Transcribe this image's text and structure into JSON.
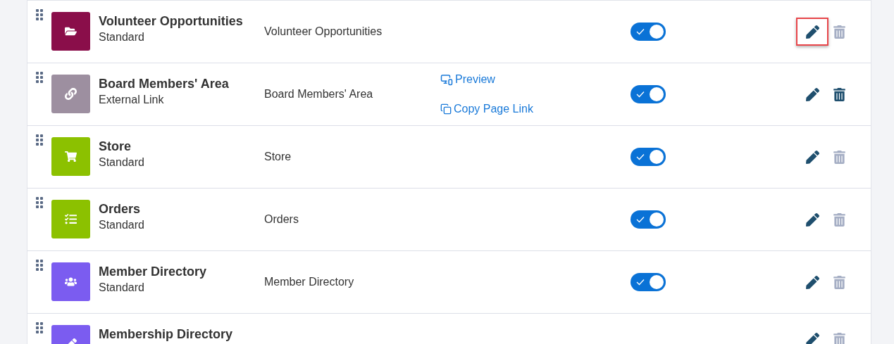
{
  "rows": [
    {
      "kind": "folder",
      "color": "#8a0e4a",
      "title": "Volunteer Opportunities",
      "subtitle": "Standard",
      "page_name": "Volunteer Opportunities",
      "links": [],
      "enabled": true,
      "edit_highlighted": true,
      "delete_disabled": true
    },
    {
      "kind": "link",
      "color": "#9d8fa0",
      "title": "Board Members' Area",
      "subtitle": "External Link",
      "page_name": "Board Members' Area",
      "links": [
        {
          "kind": "preview",
          "label": "Preview"
        },
        {
          "kind": "copy",
          "label": "Copy Page Link"
        }
      ],
      "enabled": true,
      "edit_highlighted": false,
      "delete_disabled": false
    },
    {
      "kind": "cart",
      "color": "#8cc100",
      "title": "Store",
      "subtitle": "Standard",
      "page_name": "Store",
      "links": [],
      "enabled": true,
      "edit_highlighted": false,
      "delete_disabled": true
    },
    {
      "kind": "tasks",
      "color": "#8cc100",
      "title": "Orders",
      "subtitle": "Standard",
      "page_name": "Orders",
      "links": [],
      "enabled": true,
      "edit_highlighted": false,
      "delete_disabled": true
    },
    {
      "kind": "users",
      "color": "#7b5cf0",
      "title": "Member Directory",
      "subtitle": "Standard",
      "page_name": "Member Directory",
      "links": [],
      "enabled": true,
      "edit_highlighted": false,
      "delete_disabled": true
    },
    {
      "kind": "pen",
      "color": "#7b5cf0",
      "title": "Membership Directory",
      "edit_highlighted": false,
      "delete_disabled": true
    }
  ]
}
